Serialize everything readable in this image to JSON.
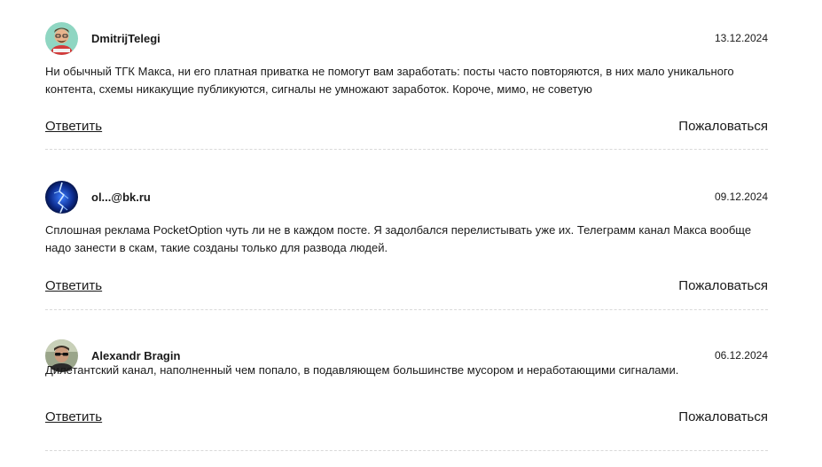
{
  "comments": [
    {
      "author": "DmitrijTelegi",
      "date": "13.12.2024",
      "text": "Ни обычный ТГК Макса, ни его платная приватка не помогут вам заработать: посты часто повторяются, в них мало уникального контента, схемы никакущие публикуются, сигналы не умножают заработок. Короче, мимо, не советую",
      "avatar": "cartoon-man-avatar",
      "reply_label": "Ответить",
      "report_label": "Пожаловаться"
    },
    {
      "author": "ol...@bk.ru",
      "date": "09.12.2024",
      "text": "Сплошная реклама PocketOption чуть ли не в каждом посте. Я задолбался перелистывать уже их. Телеграмм канал Макса вообще надо занести в скам, такие созданы только для развода людей.",
      "avatar": "blue-lightning-avatar",
      "reply_label": "Ответить",
      "report_label": "Пожаловаться"
    },
    {
      "author": "Alexandr Bragin",
      "date": "06.12.2024",
      "text": "Дилетантский канал, наполненный чем попало, в подавляющем большинстве мусором и неработающими сигналами.",
      "avatar": "man-with-sunglasses-avatar",
      "reply_label": "Ответить",
      "report_label": "Пожаловаться"
    }
  ]
}
